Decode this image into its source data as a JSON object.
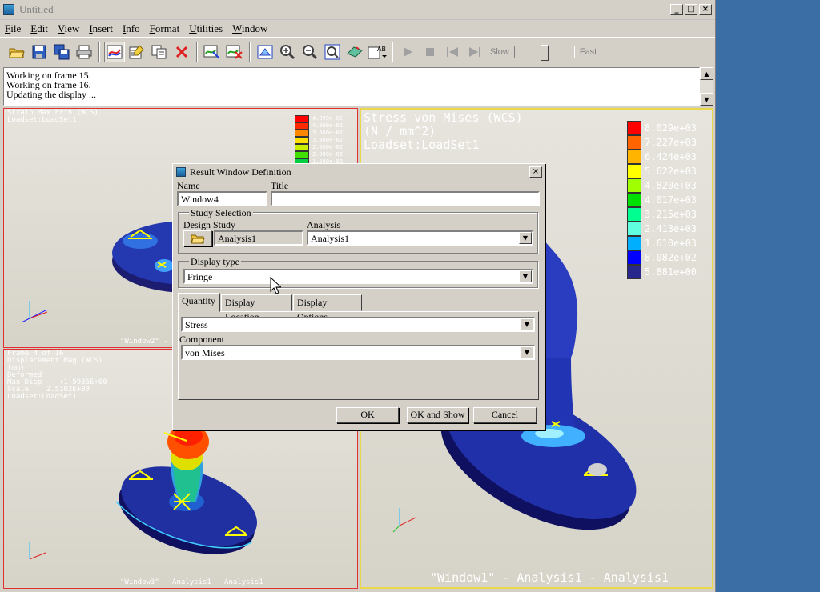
{
  "window": {
    "title": "Untitled"
  },
  "menu": [
    {
      "accel": "F",
      "rest": "ile"
    },
    {
      "accel": "E",
      "rest": "dit"
    },
    {
      "accel": "V",
      "rest": "iew"
    },
    {
      "accel": "I",
      "rest": "nsert"
    },
    {
      "accel": "I",
      "rest": "nfo"
    },
    {
      "accel": "F",
      "rest": "ormat"
    },
    {
      "accel": "U",
      "rest": "tilities"
    },
    {
      "accel": "W",
      "rest": "indow"
    }
  ],
  "toolbar": {
    "slow_label": "Slow",
    "fast_label": "Fast",
    "speed_value": 0.5
  },
  "status": {
    "lines": [
      "Working on frame 15.",
      "Working on frame 16.",
      "Updating the display ..."
    ]
  },
  "views": {
    "top_left": {
      "info": "Strain Max Prin (WCS)\nLoadset:LoadSet1",
      "caption": "\"Window2\" -",
      "legend": {
        "labels": [
          "4.099e-02",
          "4.000e-02",
          "3.500e-02",
          "3.000e-02",
          "2.500e-02",
          "2.000e-02",
          "1.500e-02"
        ],
        "colors": [
          "#ff0000",
          "#ff2a00",
          "#ff8800",
          "#ffe000",
          "#c8f000",
          "#40e000",
          "#00d040"
        ]
      }
    },
    "bottom_left": {
      "info": "Frame 4 of 16\nDisplacement Mag (WCS)\n(mm)\nDeformed\nMax Disp    +1.5936E+00\nScale    2.5102E+00\nLoadset:LoadSet1",
      "caption": "\"Window3\" - Analysis1 - Analysis1"
    },
    "right": {
      "title_lines": [
        "Stress von Mises (WCS)",
        "(N / mm^2)",
        "Loadset:LoadSet1"
      ],
      "caption": "\"Window1\" - Analysis1 - Analysis1",
      "legend": {
        "labels": [
          "8.029e+03",
          "7.227e+03",
          "6.424e+03",
          "5.622e+03",
          "4.820e+03",
          "4.017e+03",
          "3.215e+03",
          "2.413e+03",
          "1.610e+03",
          "8.082e+02",
          "5.881e+00"
        ],
        "colors": [
          "#ff0000",
          "#ff6400",
          "#ffb400",
          "#ffff00",
          "#a0ff00",
          "#00e000",
          "#00ff90",
          "#60ffe0",
          "#00b0ff",
          "#0000ff",
          "#28288c"
        ]
      }
    }
  },
  "dialog": {
    "title": "Result Window Definition",
    "name_label": "Name",
    "name_value": "Window4",
    "title_label": "Title",
    "title_value": "",
    "study_group": "Study Selection",
    "design_study_label": "Design Study",
    "design_study_value": "Analysis1",
    "analysis_label": "Analysis",
    "analysis_value": "Analysis1",
    "display_type_group": "Display type",
    "display_type_value": "Fringe",
    "tabs": [
      "Quantity",
      "Display Location",
      "Display Options"
    ],
    "quantity_value": "Stress",
    "component_label": "Component",
    "component_value": "von Mises",
    "ok_label": "OK",
    "ok_show_label": "OK and Show",
    "cancel_label": "Cancel"
  }
}
